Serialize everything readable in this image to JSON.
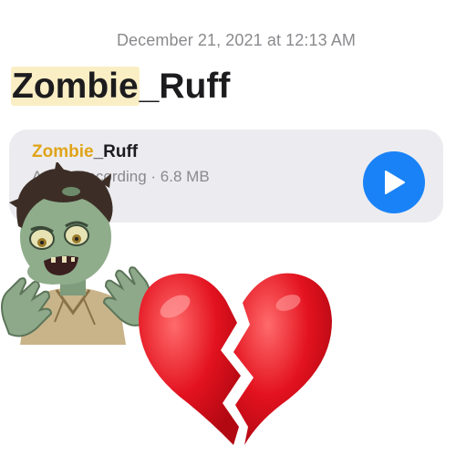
{
  "note": {
    "timestamp": "December 21, 2021 at 12:13 AM",
    "title_highlight": "Zombie",
    "title_rest": "_Ruff"
  },
  "attachment": {
    "name_highlight": "Zombie",
    "name_rest": "_Ruff",
    "subtitle": "Audio Recording · 6.8 MB",
    "play_icon": "play-icon",
    "accent_color": "#1a82f7",
    "highlight_color": "#e0a418"
  },
  "stickers": {
    "zombie": "zombie-emoji",
    "heart": "broken-heart-emoji"
  }
}
